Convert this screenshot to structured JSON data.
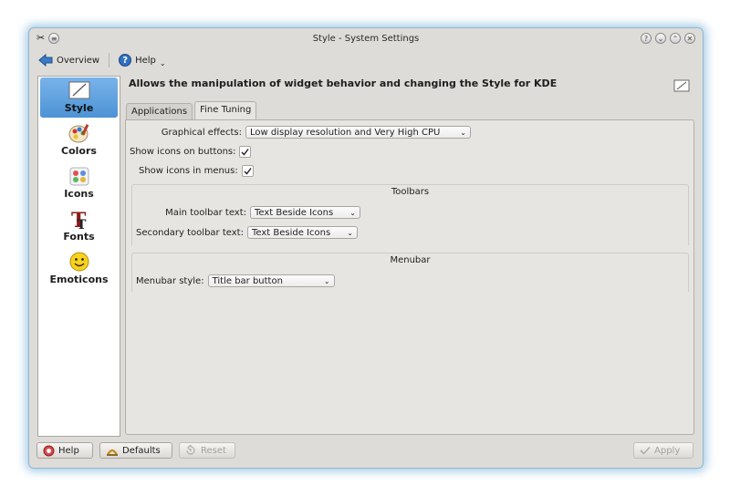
{
  "window": {
    "title": "Style - System Settings"
  },
  "toolbar": {
    "overview_label": "Overview",
    "help_label": "Help"
  },
  "sidebar": {
    "items": [
      {
        "label": "Style",
        "icon": "style-icon",
        "selected": true
      },
      {
        "label": "Colors",
        "icon": "colors-icon",
        "selected": false
      },
      {
        "label": "Icons",
        "icon": "icons-icon",
        "selected": false
      },
      {
        "label": "Fonts",
        "icon": "fonts-icon",
        "selected": false
      },
      {
        "label": "Emoticons",
        "icon": "emoticons-icon",
        "selected": false
      }
    ]
  },
  "main": {
    "heading": "Allows the manipulation of widget behavior and changing the Style for KDE",
    "tabs": [
      {
        "label": "Applications",
        "active": false
      },
      {
        "label": "Fine Tuning",
        "active": true
      }
    ],
    "graphical_effects": {
      "label": "Graphical effects:",
      "value": "Low display resolution and Very High CPU"
    },
    "show_icons_buttons": {
      "label": "Show icons on buttons:",
      "checked": true
    },
    "show_icons_menus": {
      "label": "Show icons in menus:",
      "checked": true
    },
    "toolbars_group": {
      "title": "Toolbars",
      "main_toolbar_label": "Main toolbar text:",
      "main_toolbar_value": "Text Beside Icons",
      "secondary_toolbar_label": "Secondary toolbar text:",
      "secondary_toolbar_value": "Text Beside Icons"
    },
    "menubar_group": {
      "title": "Menubar",
      "menubar_style_label": "Menubar style:",
      "menubar_style_value": "Title bar button"
    }
  },
  "bottom": {
    "help_label": "Help",
    "defaults_label": "Defaults",
    "reset_label": "Reset",
    "apply_label": "Apply"
  },
  "colors": {
    "selection": "#5a9fe0",
    "window_bg": "#dedcd8",
    "panel_bg": "#e7e5e1",
    "glow": "#5aa0d2"
  }
}
